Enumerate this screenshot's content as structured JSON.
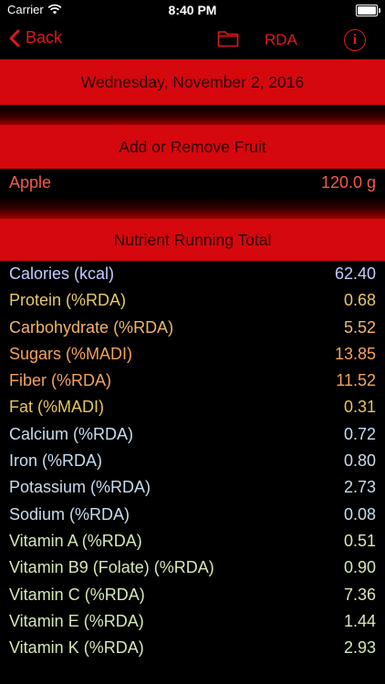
{
  "status_bar": {
    "carrier": "Carrier",
    "time": "8:40 PM"
  },
  "nav": {
    "back_label": "Back",
    "title": "RDA",
    "info_symbol": "i"
  },
  "date_bar": {
    "text": "Wednesday, November 2, 2016"
  },
  "add_bar": {
    "text": "Add or Remove Fruit"
  },
  "fruit": {
    "name": "Apple",
    "amount": "120.0 g"
  },
  "total_bar": {
    "text": "Nutrient Running Total"
  },
  "nutrients": [
    {
      "label": "Calories (kcal)",
      "value": "62.40",
      "color": "#c7c9ff"
    },
    {
      "label": "Protein (%RDA)",
      "value": "0.68",
      "color": "#e6c96a"
    },
    {
      "label": "Carbohydrate (%RDA)",
      "value": "5.52",
      "color": "#f1b46a"
    },
    {
      "label": "Sugars (%MADI)",
      "value": "13.85",
      "color": "#f4a35b"
    },
    {
      "label": "Fiber (%RDA)",
      "value": "11.52",
      "color": "#f2a45d"
    },
    {
      "label": "Fat (%MADI)",
      "value": "0.31",
      "color": "#e8c658"
    },
    {
      "label": "Calcium (%RDA)",
      "value": "0.72",
      "color": "#c9dcee"
    },
    {
      "label": "Iron (%RDA)",
      "value": "0.80",
      "color": "#c9dcee"
    },
    {
      "label": "Potassium (%RDA)",
      "value": "2.73",
      "color": "#c9dcee"
    },
    {
      "label": "Sodium (%RDA)",
      "value": "0.08",
      "color": "#c9dcee"
    },
    {
      "label": "Vitamin A (%RDA)",
      "value": "0.51",
      "color": "#d6e8b6"
    },
    {
      "label": "Vitamin B9 (Folate) (%RDA)",
      "value": "0.90",
      "color": "#d6e8b6"
    },
    {
      "label": "Vitamin C (%RDA)",
      "value": "7.36",
      "color": "#d6e8b6"
    },
    {
      "label": "Vitamin E (%RDA)",
      "value": "1.44",
      "color": "#d6e8b6"
    },
    {
      "label": "Vitamin K (%RDA)",
      "value": "2.93",
      "color": "#d6e8b6"
    }
  ],
  "colors": {
    "accent": "#e0171c",
    "bar_red": "#d5080e",
    "fruit_text": "#f25a4a"
  }
}
